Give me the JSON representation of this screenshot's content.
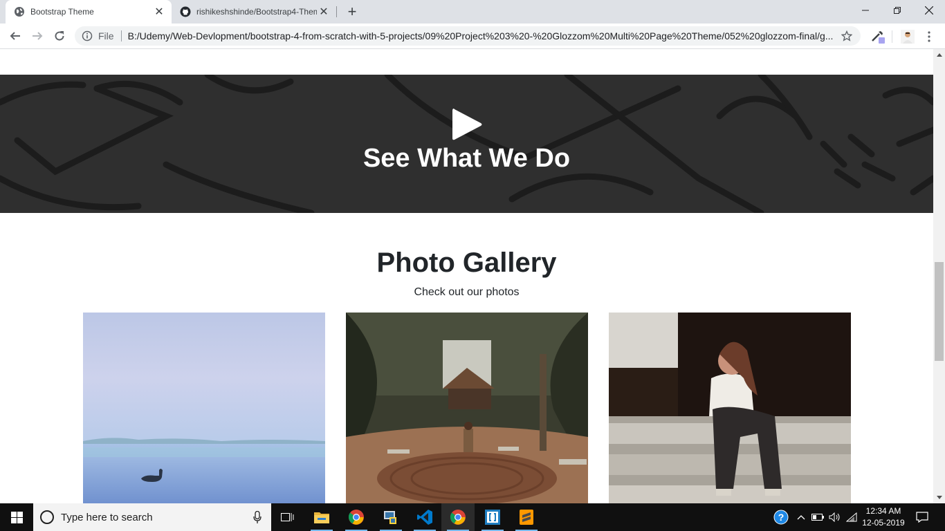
{
  "browser": {
    "tabs": [
      {
        "title": "Bootstrap Theme",
        "active": true,
        "icon": "globe-icon"
      },
      {
        "title": "rishikeshshinde/Bootstrap4-Them",
        "active": false,
        "icon": "github-icon"
      }
    ],
    "new_tab_label": "+",
    "address": {
      "scheme_label": "File",
      "url": "B:/Udemy/Web-Devlopment/bootstrap-4-from-scratch-with-5-projects/09%20Project%203%20-%20Glozzom%20Multi%20Page%20Theme/052%20glozzom-final/g..."
    }
  },
  "page": {
    "video_section": {
      "heading": "See What We Do",
      "icon": "play-icon"
    },
    "gallery": {
      "title": "Photo Gallery",
      "subtitle": "Check out our photos",
      "photos": [
        {
          "subject": "duck on misty lake"
        },
        {
          "subject": "woman in garden courtyard with gazebo"
        },
        {
          "subject": "woman covering face sitting on steps"
        }
      ]
    }
  },
  "taskbar": {
    "search_placeholder": "Type here to search",
    "pinned": [
      "task-view-icon",
      "file-explorer-icon",
      "chrome-icon",
      "python-icon",
      "vscode-icon",
      "chrome-icon",
      "brackets-icon",
      "sublime-icon"
    ],
    "clock": {
      "time": "12:34 AM",
      "date": "12-05-2019"
    }
  },
  "colors": {
    "tabstrip": "#dee1e6",
    "video_overlay": "#2e2e2e",
    "taskbar": "#101010",
    "text_dark": "#212529"
  }
}
